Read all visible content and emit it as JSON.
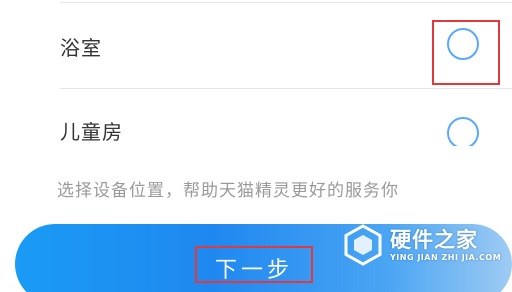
{
  "rooms": [
    {
      "label": "浴室",
      "selected": false
    },
    {
      "label": "儿童房",
      "selected": false
    }
  ],
  "hint": "选择设备位置，帮助天猫精灵更好的服务你",
  "next_button": {
    "label": "下一步"
  },
  "watermark": {
    "name": "硬件之家",
    "url": "YING JIAN ZHI JIA.COM"
  },
  "colors": {
    "accent": "#1f88f0",
    "radio": "#57a9ff",
    "highlight": "#e4393c"
  }
}
